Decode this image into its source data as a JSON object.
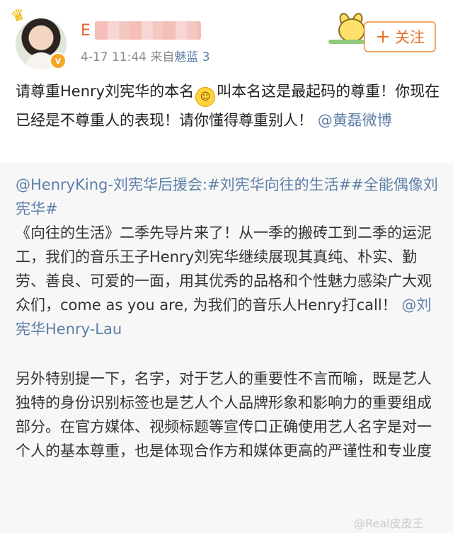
{
  "user": {
    "name": "E",
    "timestamp": "4-17 11:44",
    "source_prefix": "来自",
    "source": "魅蓝 3",
    "verified_badge": "v"
  },
  "follow_button": {
    "plus": "+",
    "label": "关注"
  },
  "post": {
    "text": "请尊重Henry刘宪华的本名",
    "emoji": "☺",
    "text_after_emoji": "叫本名这是最起码的尊重！你现在已经是不尊重人的表现！请你懂得尊重别人！",
    "mention": "@黄磊微博"
  },
  "repost": {
    "header_link": "@HenryKing-刘宪华后援会:#刘宪华向往的生活##全能偶像刘宪华#",
    "paragraph1": "《向往的生活》二季先导片来了！从一季的搬砖工到二季的运泥工，我们的音乐王子Henry刘宪华继续展现其真纯、朴实、勤劳、善良、可爱的一面，用其优秀的品格和个性魅力感染广大观众们，come as you are, 为我们的音乐人Henry打call！",
    "paragraph1_mention": "@刘宪华Henry-Lau",
    "paragraph2": "另外特别提一下，名字，对于艺人的重要性不言而喻，既是艺人独特的身份识别标签也是艺人个人品牌形象和影响力的重要组成部分。在官方媒体、视频标题等宣传口正确使用艺人名字是对一个人的基本尊重，也是体现合作方和媒体更高的严谨性和专业度"
  },
  "watermark": "@Real皮皮王",
  "icons": [
    "crown-icon",
    "verified-icon",
    "mascot-icon",
    "plus-icon",
    "smiley-emoji-icon"
  ],
  "colors": {
    "username": "#e8602b",
    "link": "#5d7fa8",
    "follow": "#e8702a",
    "repost_bg": "#f7f7f7"
  }
}
